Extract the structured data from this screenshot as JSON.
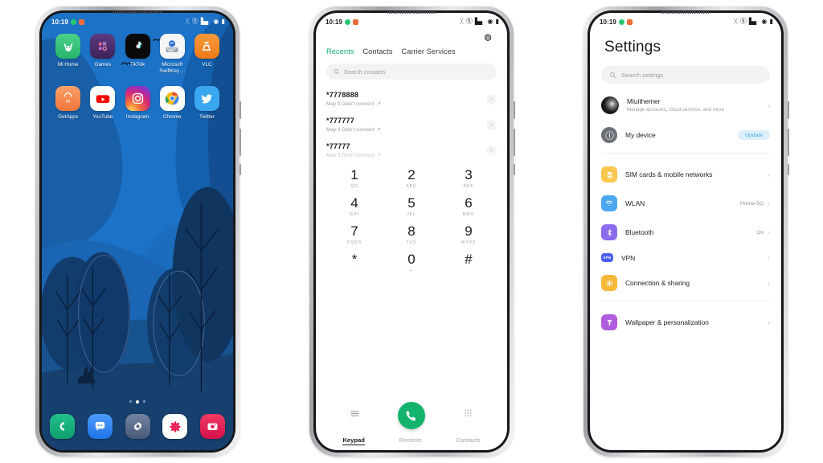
{
  "statusbar": {
    "time": "10:19",
    "left_badges": [
      "green-dot-icon",
      "orange-dot-icon"
    ],
    "right_icons": [
      "bluetooth-icon",
      "dnd-icon",
      "signal-icon",
      "wifi-icon",
      "battery-icon"
    ]
  },
  "home": {
    "rows": [
      [
        {
          "label": "Mi Home",
          "icon": "mi-home-icon",
          "color": "#3ec17f",
          "glyph": "M"
        },
        {
          "label": "Games",
          "icon": "games-icon",
          "color": "#4b2b63",
          "glyph": "⬤"
        },
        {
          "label": "TikTok",
          "icon": "tiktok-icon",
          "color": "#0b0b0b",
          "glyph": "♪"
        },
        {
          "label": "Microsoft\nSwiftKey ...",
          "icon": "swiftkey-icon",
          "color": "#f3f4f6",
          "glyph": "⌨"
        },
        {
          "label": "VLC",
          "icon": "vlc-icon",
          "color": "#f08020",
          "glyph": "▲"
        }
      ],
      [
        {
          "label": "GetApps",
          "icon": "getapps-icon",
          "color": "#f3803f",
          "glyph": "mi"
        },
        {
          "label": "YouTube",
          "icon": "youtube-icon",
          "color": "#ffffff",
          "glyph": "▶"
        },
        {
          "label": "Instagram",
          "icon": "instagram-icon",
          "color": "#d82d7e",
          "glyph": "◎"
        },
        {
          "label": "Chrome",
          "icon": "chrome-icon",
          "color": "#ffffff",
          "glyph": "◉"
        },
        {
          "label": "Twitter",
          "icon": "twitter-icon",
          "color": "#38a1f3",
          "glyph": "ᴠ"
        }
      ]
    ],
    "page_dots": 3,
    "active_dot": 1,
    "dock": [
      {
        "name": "phone-app",
        "color": "#17a877",
        "glyph": "✆"
      },
      {
        "name": "messages-app",
        "color": "#2f82f4",
        "glyph": "⋯"
      },
      {
        "name": "settings-app",
        "color": "#5a6b82",
        "glyph": "⚙"
      },
      {
        "name": "themes-app",
        "color": "#ffffff",
        "glyph": "✹"
      },
      {
        "name": "camera-app",
        "color": "#e3194e",
        "glyph": "◉"
      }
    ]
  },
  "dialer": {
    "settings_icon": "gear-icon",
    "tabs": [
      {
        "label": "Recents",
        "active": true
      },
      {
        "label": "Contacts",
        "active": false
      },
      {
        "label": "Carrier Services",
        "active": false
      }
    ],
    "search_placeholder": "Search contacts",
    "search_icon": "search-icon",
    "calls": [
      {
        "number": "*7778888",
        "detail": "May 9 Didn't connect",
        "direction": "outgoing-arrow-icon"
      },
      {
        "number": "*777777",
        "detail": "May 4 Didn't connect",
        "direction": "outgoing-arrow-icon"
      },
      {
        "number": "*77777",
        "detail": "May 3 Didn't connect",
        "direction": "outgoing-arrow-icon"
      }
    ],
    "keypad": [
      [
        {
          "d": "1",
          "l": "QD"
        },
        {
          "d": "2",
          "l": "ABC"
        },
        {
          "d": "3",
          "l": "DEF"
        }
      ],
      [
        {
          "d": "4",
          "l": "GHI"
        },
        {
          "d": "5",
          "l": "JKL"
        },
        {
          "d": "6",
          "l": "MNO"
        }
      ],
      [
        {
          "d": "7",
          "l": "PQRS"
        },
        {
          "d": "8",
          "l": "TUV"
        },
        {
          "d": "9",
          "l": "WXYZ"
        }
      ],
      [
        {
          "d": "*",
          "l": "."
        },
        {
          "d": "0",
          "l": "+"
        },
        {
          "d": "#",
          "l": ""
        }
      ]
    ],
    "actions": {
      "menu_icon": "hamburger-icon",
      "call_icon": "call-icon",
      "grid_icon": "dialpad-grid-icon"
    },
    "nav": [
      {
        "label": "Keypad",
        "active": true
      },
      {
        "label": "Recents",
        "active": false
      },
      {
        "label": "Contacts",
        "active": false
      }
    ]
  },
  "settings": {
    "title": "Settings",
    "search_placeholder": "Search settings",
    "search_icon": "search-icon",
    "account": {
      "name": "Miuithemer",
      "subtitle": "Manage accounts, cloud services, and more",
      "avatar": "user-avatar"
    },
    "device": {
      "label": "My device",
      "icon": "device-info-icon",
      "badge": "Update"
    },
    "items": [
      {
        "label": "SIM cards & mobile networks",
        "icon": "sim-card-icon",
        "color": "#f8c74a",
        "glyph": "▮",
        "value": ""
      },
      {
        "label": "WLAN",
        "icon": "wifi-icon",
        "color": "#4aa8f0",
        "glyph": "◑",
        "value": "Home-5G"
      },
      {
        "label": "Bluetooth",
        "icon": "bluetooth-icon",
        "color": "#8b6cf0",
        "glyph": "ᛗ",
        "value": "On"
      },
      {
        "label": "VPN",
        "icon": "vpn-icon",
        "color": "#4a5ef0",
        "glyph": "VPN",
        "value": ""
      },
      {
        "label": "Connection & sharing",
        "icon": "connection-sharing-icon",
        "color": "#f8b83a",
        "glyph": "✹",
        "value": ""
      },
      {
        "label": "Wallpaper & personalization",
        "icon": "wallpaper-icon",
        "color": "#b05ede",
        "glyph": "⚑",
        "value": ""
      }
    ]
  }
}
